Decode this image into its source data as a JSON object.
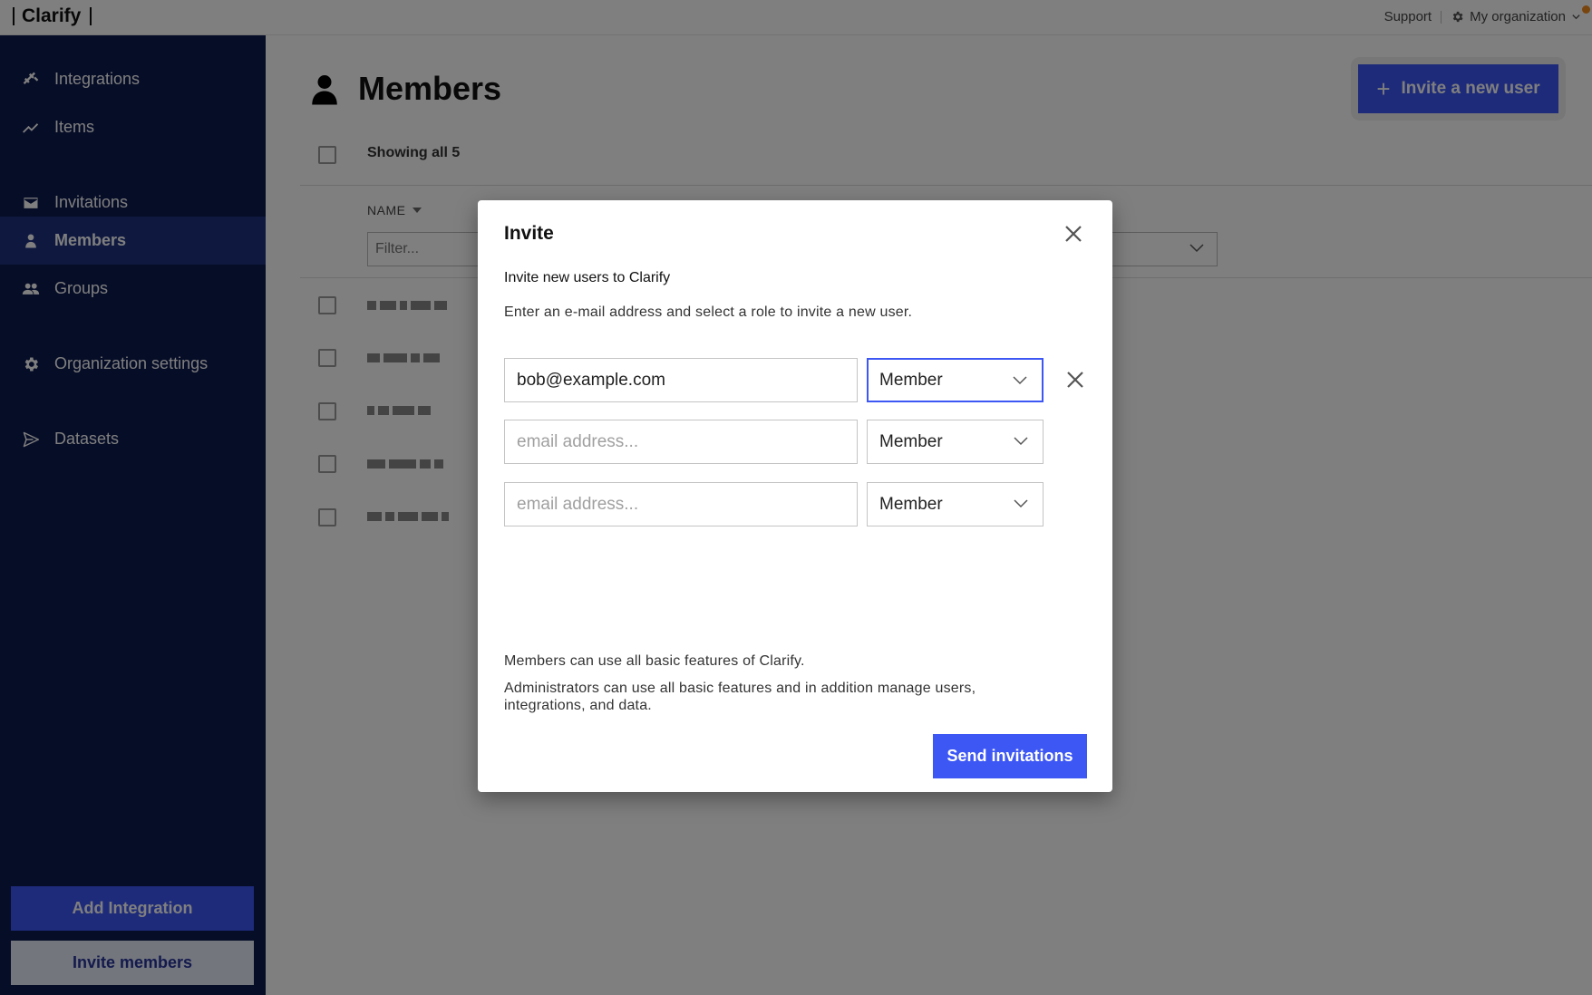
{
  "topbar": {
    "brand": "Clarify",
    "support_label": "Support",
    "org_label": "My organization"
  },
  "sidebar": {
    "items": [
      {
        "label": "Integrations",
        "icon": "plug-icon"
      },
      {
        "label": "Items",
        "icon": "trend-line-icon"
      },
      {
        "label": "Invitations",
        "icon": "envelope-icon"
      },
      {
        "label": "Members",
        "icon": "person-icon",
        "active": true
      },
      {
        "label": "Groups",
        "icon": "people-icon"
      },
      {
        "label": "Organization settings",
        "icon": "gear-icon"
      },
      {
        "label": "Datasets",
        "icon": "send-icon"
      }
    ],
    "add_integration_label": "Add Integration",
    "invite_members_label": "Invite members"
  },
  "main": {
    "title": "Members",
    "invite_button_label": "Invite a new user",
    "showing_text": "Showing all 5",
    "name_column": "NAME",
    "filter_placeholder": "Filter..."
  },
  "modal": {
    "title": "Invite",
    "subtitle": "Invite new users to Clarify",
    "description": "Enter an e-mail address and select a role to invite a new user.",
    "rows": [
      {
        "email": "bob@example.com",
        "placeholder": "email address...",
        "role": "Member"
      },
      {
        "email": "",
        "placeholder": "email address...",
        "role": "Member"
      },
      {
        "email": "",
        "placeholder": "email address...",
        "role": "Member"
      }
    ],
    "info_members": "Members can use all basic features of Clarify.",
    "info_admins": "Administrators can use all basic features and in addition manage users, integrations, and data.",
    "send_label": "Send invitations"
  },
  "colors": {
    "sidebar_bg": "#0d1a4f",
    "sidebar_active": "#1f3380",
    "accent": "#3d57f5",
    "notification": "#f08a1c"
  }
}
